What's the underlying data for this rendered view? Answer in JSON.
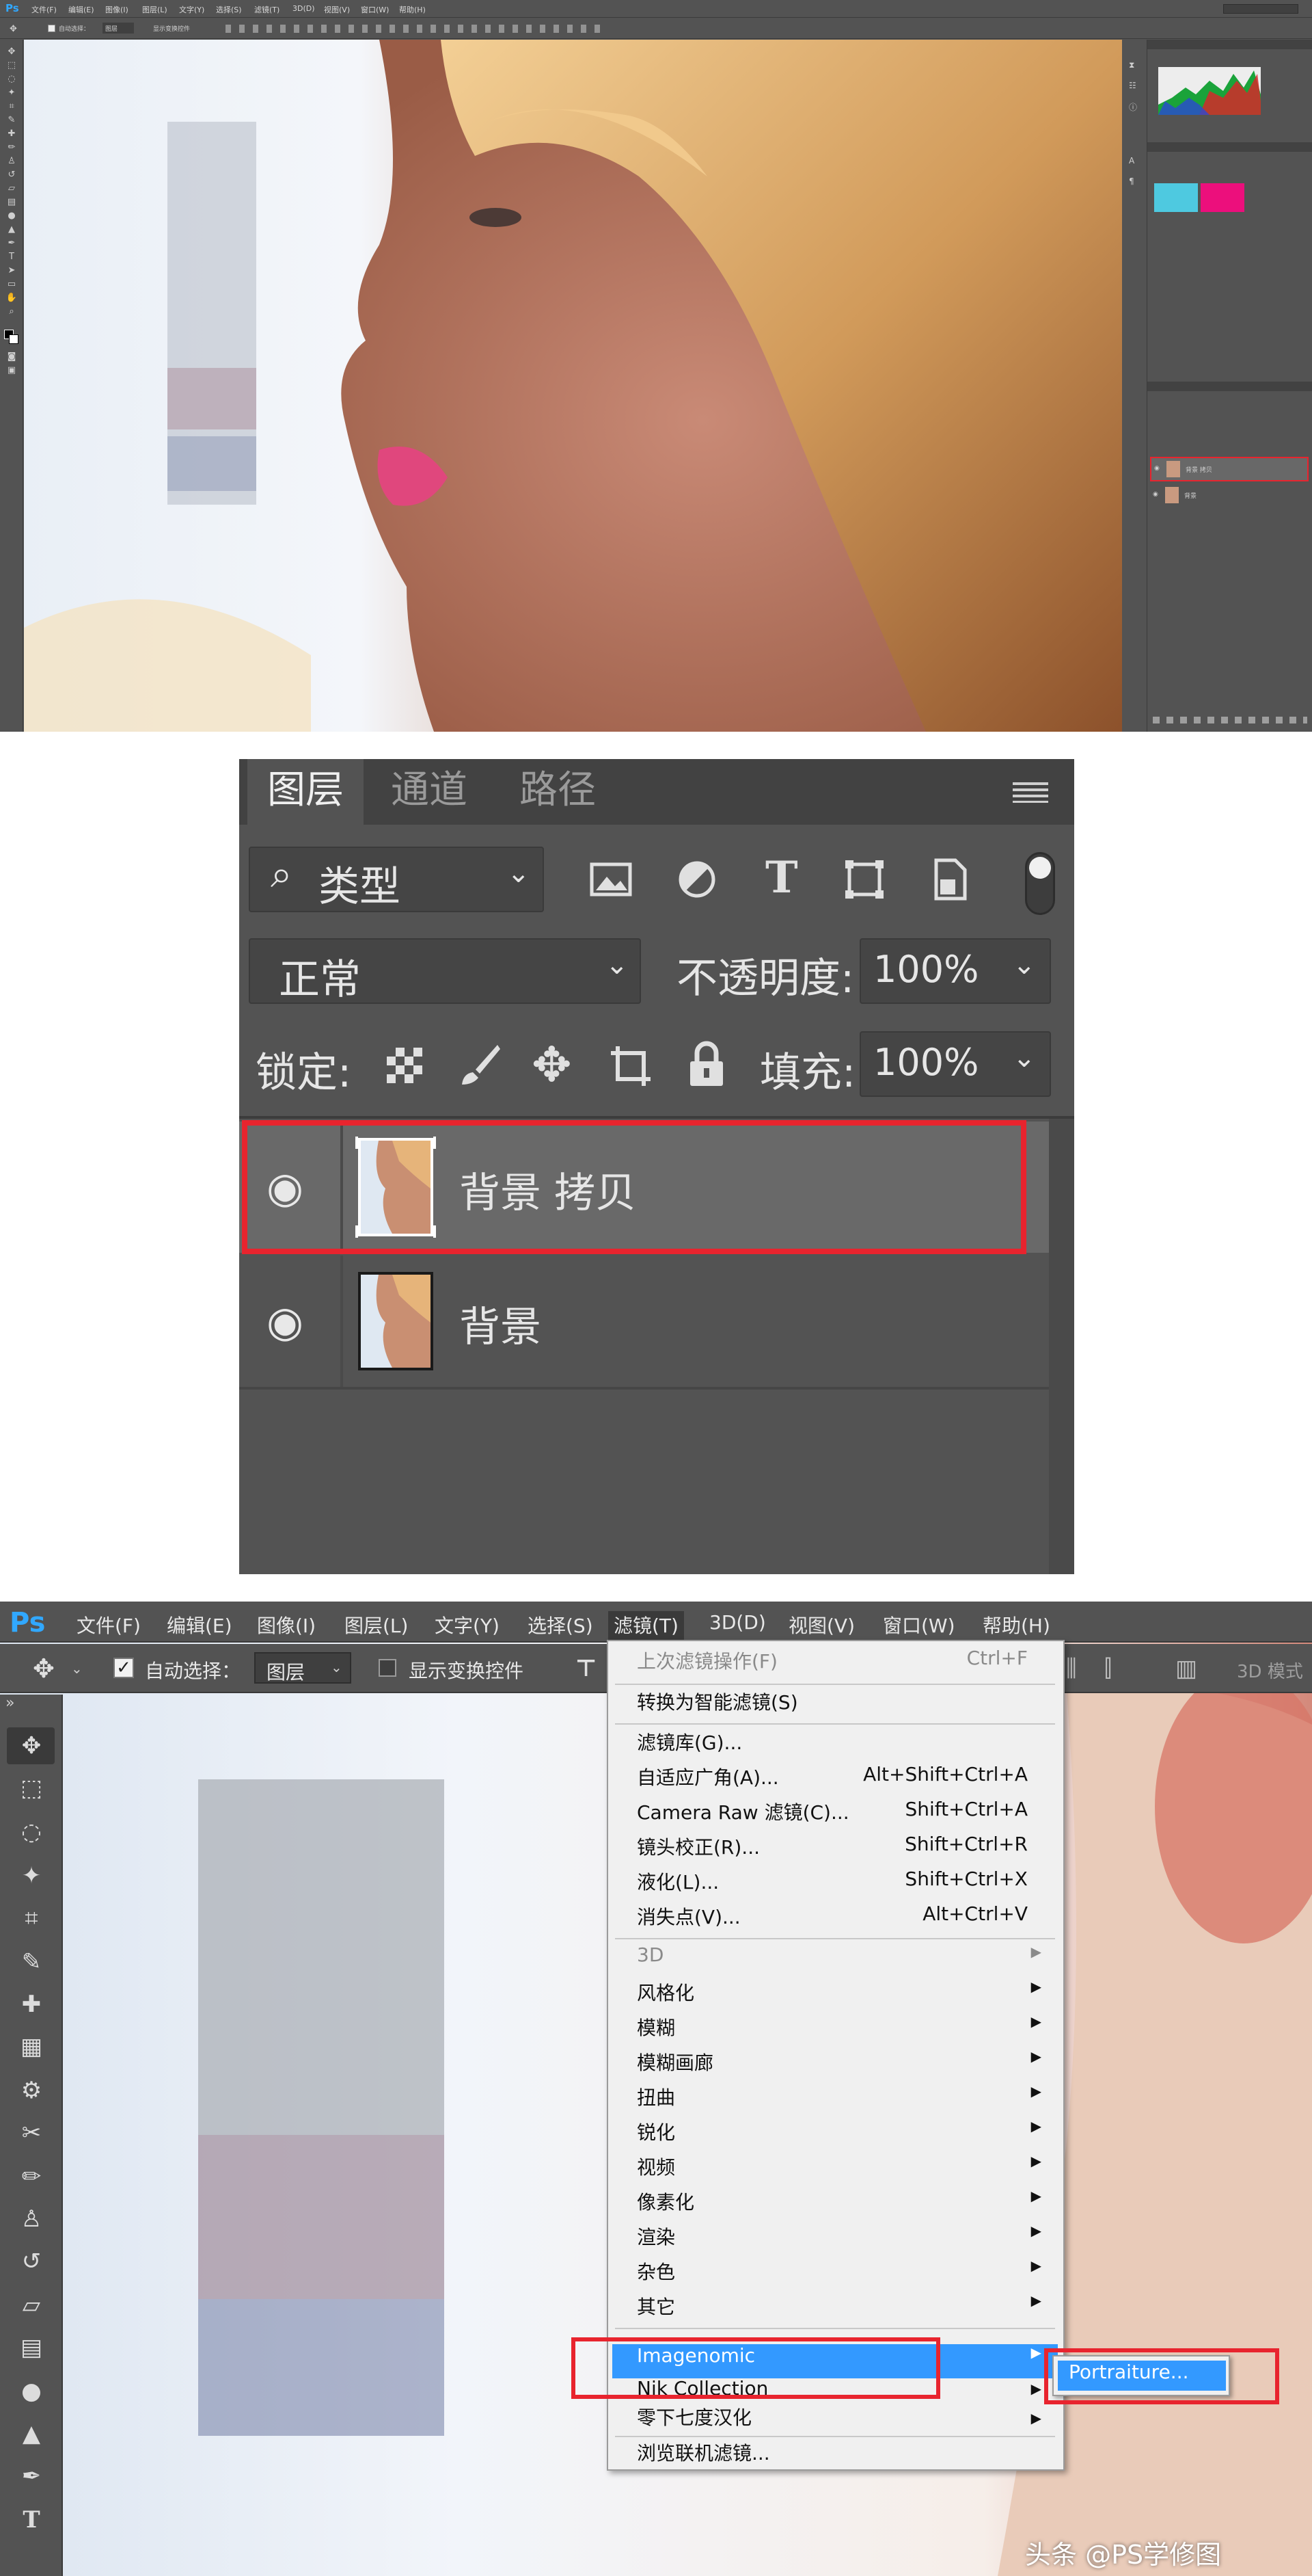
{
  "app": {
    "logo": "Ps",
    "menu": [
      "文件(F)",
      "编辑(E)",
      "图像(I)",
      "图层(L)",
      "文字(Y)",
      "选择(S)",
      "滤镜(T)",
      "3D(D)",
      "视图(V)",
      "窗口(W)",
      "帮助(H)"
    ]
  },
  "options_bar": {
    "auto_select_label": "自动选择：",
    "auto_select_checked": true,
    "auto_select_value": "图层",
    "show_transform_label": "显示变换控件",
    "mode_3d_label": "3D 模式"
  },
  "layers_panel": {
    "tabs": [
      "图层",
      "通道",
      "路径"
    ],
    "filter_kind": "类型",
    "blend_mode": "正常",
    "opacity_label": "不透明度:",
    "opacity_value": "100%",
    "lock_label": "锁定:",
    "fill_label": "填充:",
    "fill_value": "100%",
    "layers": [
      {
        "name": "背景 拷贝",
        "selected": true,
        "visible": true
      },
      {
        "name": "背景",
        "selected": false,
        "visible": true
      }
    ]
  },
  "filter_menu": {
    "title": "滤镜(T)",
    "items": [
      {
        "label": "上次滤镜操作(F)",
        "shortcut": "Ctrl+F",
        "disabled": true
      },
      {
        "separator": true
      },
      {
        "label": "转换为智能滤镜(S)"
      },
      {
        "separator": true
      },
      {
        "label": "滤镜库(G)..."
      },
      {
        "label": "自适应广角(A)...",
        "shortcut": "Alt+Shift+Ctrl+A"
      },
      {
        "label": "Camera Raw 滤镜(C)...",
        "shortcut": "Shift+Ctrl+A"
      },
      {
        "label": "镜头校正(R)...",
        "shortcut": "Shift+Ctrl+R"
      },
      {
        "label": "液化(L)...",
        "shortcut": "Shift+Ctrl+X"
      },
      {
        "label": "消失点(V)...",
        "shortcut": "Alt+Ctrl+V"
      },
      {
        "separator": true
      },
      {
        "label": "3D",
        "submenu": true,
        "disabled": true
      },
      {
        "label": "风格化",
        "submenu": true
      },
      {
        "label": "模糊",
        "submenu": true
      },
      {
        "label": "模糊画廊",
        "submenu": true
      },
      {
        "label": "扭曲",
        "submenu": true
      },
      {
        "label": "锐化",
        "submenu": true
      },
      {
        "label": "视频",
        "submenu": true
      },
      {
        "label": "像素化",
        "submenu": true
      },
      {
        "label": "渲染",
        "submenu": true
      },
      {
        "label": "杂色",
        "submenu": true
      },
      {
        "label": "其它",
        "submenu": true
      },
      {
        "separator": true
      },
      {
        "label": "Imagenomic",
        "submenu": true,
        "highlighted": true
      },
      {
        "label": "Nik Collection",
        "submenu": true
      },
      {
        "label": "零下七度汉化",
        "submenu": true
      },
      {
        "separator": true
      },
      {
        "label": "浏览联机滤镜..."
      }
    ],
    "submenu_item": "Portraiture..."
  },
  "watermark": "头条 @PS学修图",
  "colors": {
    "ps_blue": "#31a8ff",
    "highlight": "#3399ff",
    "red_box": "#e8242e",
    "panel_gray": "#535353",
    "swatch_cyan": "#4ec9e0",
    "swatch_pink": "#ec0f7c"
  }
}
